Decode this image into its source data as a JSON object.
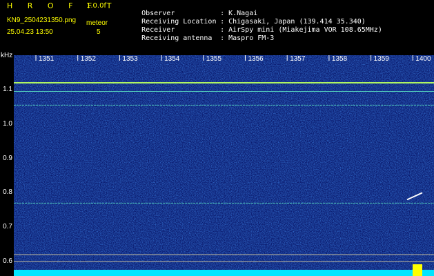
{
  "header": {
    "logo": "H R O F F T",
    "version": "1.0.0f",
    "filename": "KN9_2504231350.png",
    "mode": "meteor",
    "timestamp": "25.04.23 13:50",
    "count": "5",
    "info": [
      {
        "label": "Observer",
        "value": "K.Nagai"
      },
      {
        "label": "Receiving Location",
        "value": "Chigasaki, Japan (139.414 35.340)"
      },
      {
        "label": "Receiver",
        "value": "AirSpy mini (Miakejima VOR 108.65MHz)"
      },
      {
        "label": "Receiving antenna",
        "value": "Maspro FM-3"
      }
    ]
  },
  "colors": {
    "header_text": "#ffff00",
    "background": "#000000",
    "waterfall_base": "#0a1a6e",
    "signal_line": "#66ffcc",
    "baseline": "#00e5ff",
    "hot_spot": "#ffff00"
  },
  "chart_data": {
    "type": "heatmap",
    "ylabel": "kHz",
    "yticks": [
      "1.1",
      "1.0",
      "0.9",
      "0.8",
      "0.7",
      "0.6"
    ],
    "xticks": [
      "1351",
      "1352",
      "1353",
      "1354",
      "1355",
      "1356",
      "1357",
      "1358",
      "1359",
      "1400"
    ],
    "ylim": [
      0.57,
      1.2
    ],
    "horizontal_lines_khz": [
      1.12,
      1.095,
      1.055,
      0.77,
      0.62,
      0.6
    ],
    "meteor_echo": {
      "x_start": "1400",
      "khz_range": [
        0.78,
        0.8
      ]
    }
  }
}
